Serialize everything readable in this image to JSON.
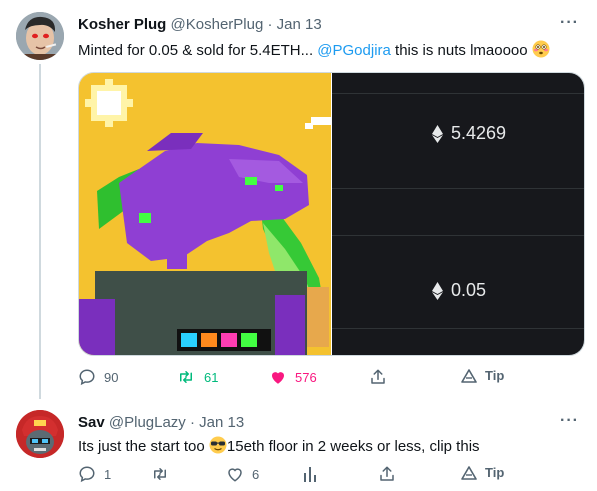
{
  "tweets": [
    {
      "name": "Kosher Plug",
      "handle": "@KosherPlug",
      "dot": "·",
      "time": "Jan 13",
      "text_prefix": "Minted for 0.05 & sold for 5.4ETH... ",
      "mention": "@PGodjira",
      "text_suffix": " this is nuts lmaoooo",
      "emoji": "flushed-face-emoji",
      "media": {
        "prices": [
          "5.4269",
          "0.05"
        ],
        "currency_icon": "ethereum-icon",
        "image": "pixel-godzilla-nft"
      },
      "actions": {
        "replies": "90",
        "retweets": "61",
        "likes": "576",
        "tip_label": "Tip"
      }
    },
    {
      "name": "Sav",
      "handle": "@PlugLazy",
      "dot": "·",
      "time": "Jan 13",
      "text_prefix": "Its just the start too ",
      "emoji": "sunglasses-face-emoji",
      "text_suffix": "15eth floor in 2 weeks or less, clip this",
      "actions": {
        "replies": "1",
        "retweets": "",
        "likes": "6",
        "tip_label": "Tip"
      }
    }
  ],
  "colors": {
    "accent": "#1d9bf0",
    "retweet_active": "#00ba7c",
    "like_active": "#f91880",
    "muted": "#536471"
  }
}
